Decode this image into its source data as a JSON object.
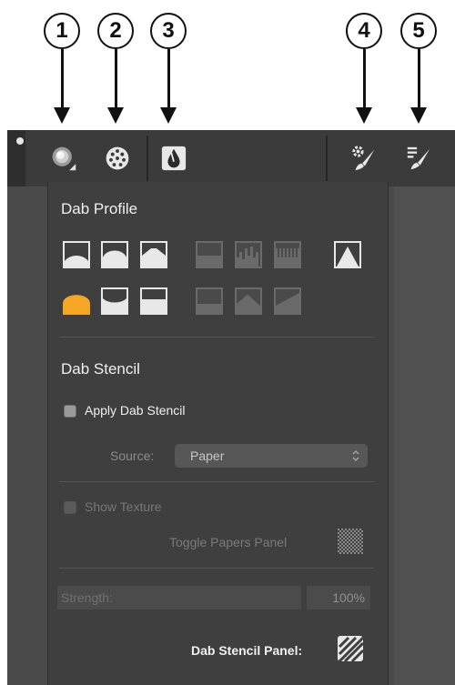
{
  "callouts": [
    "1",
    "2",
    "3",
    "4",
    "5"
  ],
  "toolbar": {
    "buttons": [
      "brush-category-icon",
      "brush-variants-icon",
      "stroke-attributes-icon",
      "brush-settings-icon",
      "brush-library-icon"
    ]
  },
  "dab_profile": {
    "title": "Dab Profile",
    "selected_profile_row": 2,
    "selected_profile_col": 1,
    "selected_color": "#f5a623"
  },
  "dab_stencil": {
    "title": "Dab Stencil",
    "apply_label": "Apply Dab Stencil",
    "apply_checked": false,
    "source_label": "Source:",
    "source_value": "Paper",
    "show_texture_label": "Show Texture",
    "show_texture_checked": false,
    "toggle_papers_label": "Toggle Papers Panel",
    "strength_label": "Strength:",
    "strength_value": "100%",
    "stencil_panel_label": "Dab Stencil Panel:"
  }
}
